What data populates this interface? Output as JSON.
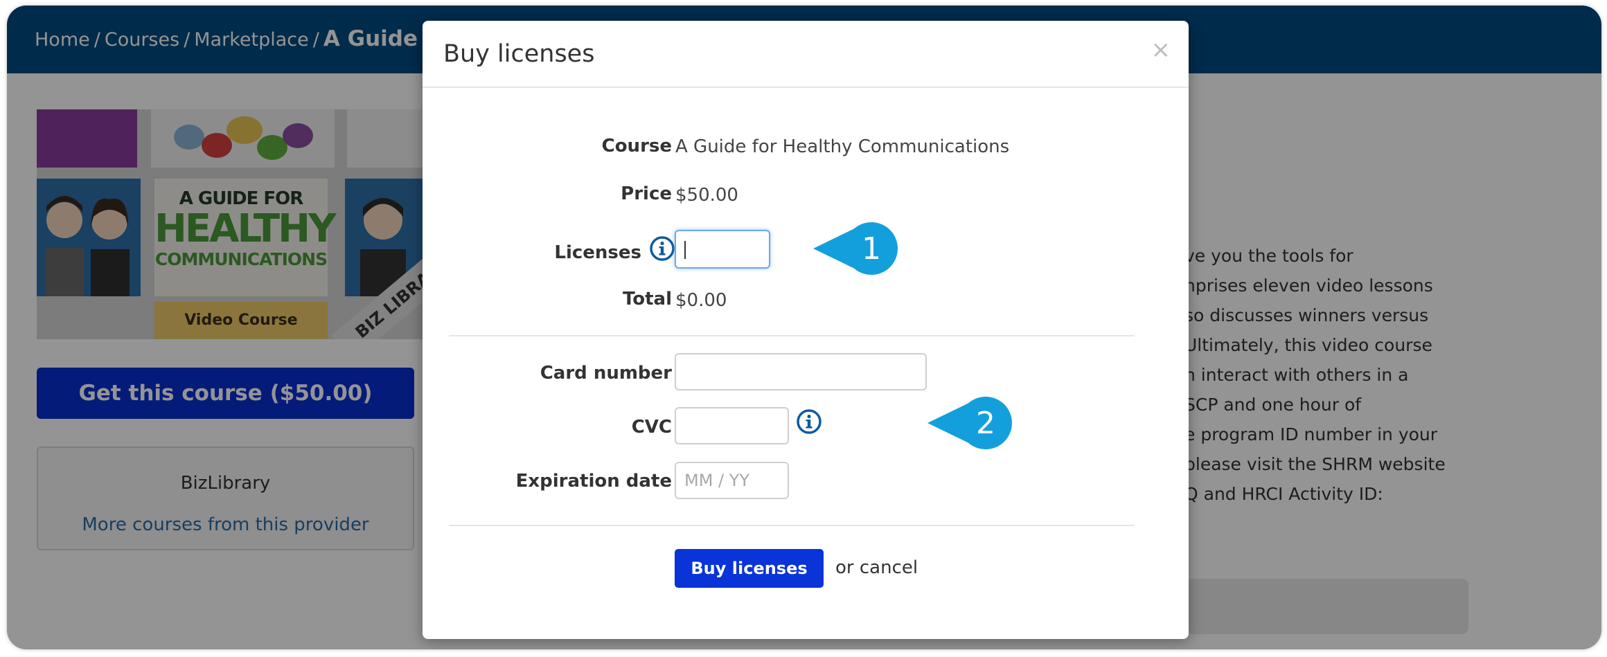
{
  "breadcrumb": {
    "items": [
      "Home",
      "Courses",
      "Marketplace"
    ],
    "separator": "/",
    "current": "A Guide for"
  },
  "course_image": {
    "line1": "A GUIDE FOR",
    "line2": "HEALTHY",
    "line3": "COMMUNICATIONS",
    "video_label": "Video Course",
    "ribbon": "BIZ LIBRA"
  },
  "sidebar": {
    "get_course_label": "Get this course ($50.00)",
    "provider_name": "BizLibrary",
    "provider_link": "More courses from this provider"
  },
  "description": {
    "lines": [
      "ve you the tools for",
      "nprises eleven video lessons",
      "so discusses winners versus",
      "Ultimately, this video course",
      "n interact with others in a",
      "SCP and one hour of",
      "e program ID number in your",
      "please visit the SHRM website",
      "Q and HRCI Activity ID:"
    ]
  },
  "modal": {
    "title": "Buy licenses",
    "close_glyph": "×",
    "course_label": "Course",
    "course_value": "A Guide for Healthy Communications",
    "price_label": "Price",
    "price_value": "$50.00",
    "licenses_label": "Licenses",
    "licenses_value": "",
    "total_label": "Total",
    "total_value": "$0.00",
    "card_number_label": "Card number",
    "cvc_label": "CVC",
    "expiration_label": "Expiration date",
    "expiration_placeholder": "MM / YY",
    "buy_button_label": "Buy licenses",
    "cancel_text": "or cancel"
  },
  "callouts": [
    {
      "number": "1"
    },
    {
      "number": "2"
    }
  ],
  "colors": {
    "header": "#014a82",
    "primary_button": "#0a34d8",
    "callout": "#139fdc",
    "info_icon": "#0e5a9c"
  },
  "icons": {
    "info": "info-circle-icon",
    "close": "close-icon"
  }
}
